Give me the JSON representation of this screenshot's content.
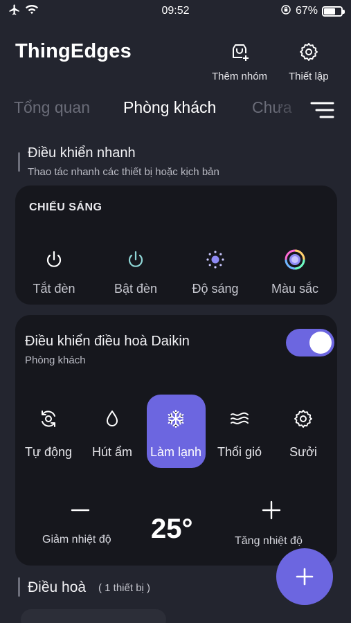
{
  "status_bar": {
    "time": "09:52",
    "battery_text": "67%",
    "battery_level": 0.67
  },
  "header": {
    "app_title": "ThingEdges",
    "add_group_label": "Thêm nhóm",
    "settings_label": "Thiết lập"
  },
  "tabs": [
    {
      "label": "Tổng quan",
      "active": false
    },
    {
      "label": "Phòng khách",
      "active": true
    },
    {
      "label": "Chưa",
      "active": false
    }
  ],
  "quick_control": {
    "title": "Điều khiển nhanh",
    "subtitle": "Thao tác nhanh các thiết bị hoặc kịch bản"
  },
  "lighting_card": {
    "heading": "CHIẾU SÁNG",
    "controls": [
      {
        "label": "Tắt đèn",
        "icon": "power-off-icon"
      },
      {
        "label": "Bật đèn",
        "icon": "power-on-icon"
      },
      {
        "label": "Độ sáng",
        "icon": "brightness-icon"
      },
      {
        "label": "Màu sắc",
        "icon": "color-wheel-icon"
      }
    ]
  },
  "ac_card": {
    "title": "Điều khiển điều hoà Daikin",
    "room": "Phòng khách",
    "power_on": true,
    "modes": [
      {
        "label": "Tự động",
        "icon": "auto-mode-icon",
        "active": false
      },
      {
        "label": "Hút ẩm",
        "icon": "dry-mode-icon",
        "active": false
      },
      {
        "label": "Làm lạnh",
        "icon": "snowflake-icon",
        "active": true
      },
      {
        "label": "Thổi gió",
        "icon": "fan-mode-icon",
        "active": false
      },
      {
        "label": "Sưởi",
        "icon": "heat-mode-icon",
        "active": false
      }
    ],
    "decrease_label": "Giảm nhiệt độ",
    "temperature": "25°",
    "increase_label": "Tăng nhiệt độ"
  },
  "device_section": {
    "title": "Điều hoà",
    "count": "( 1 thiết bị )"
  },
  "colors": {
    "background": "#23252f",
    "card": "#16171d",
    "accent": "#6c66e0",
    "power_on_icon": "#8fd6d6"
  }
}
